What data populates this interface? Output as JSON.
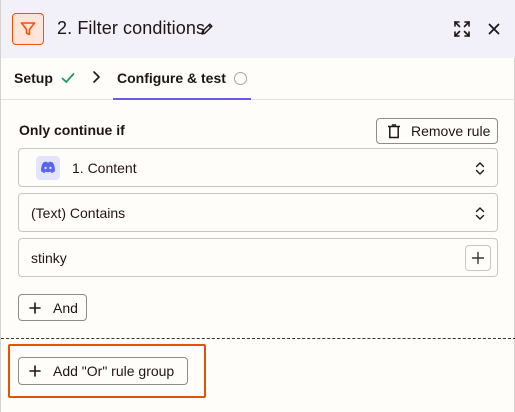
{
  "header": {
    "title": "2. Filter conditions",
    "icons": {
      "app": "filter-icon",
      "edit": "pencil-icon",
      "expand": "expand-icon",
      "close": "close-icon"
    }
  },
  "tabs": {
    "setup_label": "Setup",
    "setup_status": "complete",
    "configure_label": "Configure & test",
    "configure_status": "incomplete"
  },
  "filter": {
    "heading": "Only continue if",
    "remove_rule_label": "Remove rule",
    "field_value": "1. Content",
    "field_app_icon": "discord-icon",
    "condition_value": "(Text) Contains",
    "comparison_value": "stinky",
    "and_label": "And",
    "or_group_label": "Add \"Or\" rule group"
  },
  "colors": {
    "accent": "#695be8",
    "brand": "#ff4f00",
    "highlight": "#e35205",
    "success": "#1b9c62",
    "discord": "#5865f2"
  }
}
